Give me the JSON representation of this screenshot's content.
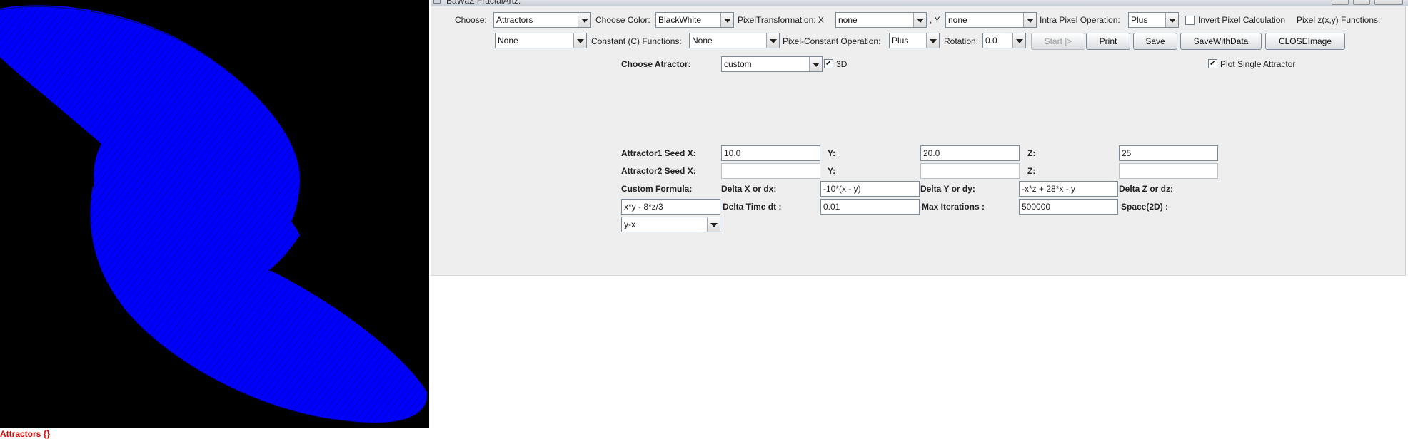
{
  "window": {
    "title": "BaWaZ FractalArtz:"
  },
  "image_panel": {
    "caption": "Attractors {}",
    "background": "#000000",
    "plot_color": "#0000ff"
  },
  "toolbar": {
    "choose_label": "Choose:",
    "choose_value": "Attractors",
    "choose_color_label": "Choose Color:",
    "choose_color_value": "BlackWhite",
    "pixel_transformation_label": "PixelTransformation:  X",
    "pixel_transformation_x": "none",
    "y_label": ",  Y",
    "pixel_transformation_y": "none",
    "intra_pixel_label": "Intra Pixel Operation:",
    "intra_pixel_value": "Plus",
    "invert_label": "Invert Pixel Calculation",
    "invert_checked": false,
    "pixel_functions_label": "Pixel z(x,y) Functions:",
    "pixel_functions_value": "None",
    "constant_functions_label": "Constant (C) Functions:",
    "constant_functions_value": "None",
    "pixel_constant_label": "Pixel-Constant Operation:",
    "pixel_constant_value": "Plus",
    "rotation_label": "Rotation:",
    "rotation_value": "0.0",
    "start_button": "Start |>",
    "print_button": "Print",
    "save_button": "Save",
    "save_with_data_button": "SaveWithData",
    "close_image_button": "CLOSEImage"
  },
  "attractor": {
    "choose_label": "Choose Atractor:",
    "choose_value": "custom",
    "three_d_label": "3D",
    "three_d_checked": true,
    "plot_single_label": "Plot Single Attractor",
    "plot_single_checked": true,
    "attractor1_label": "Attractor1   Seed   X:",
    "attractor2_label": "Attractor2   Seed   X:",
    "y_label": "Y:",
    "z_label": "Z:",
    "seed1_x": "10.0",
    "seed1_y": "20.0",
    "seed1_z": "25",
    "seed2_x": "",
    "seed2_y": "",
    "seed2_z": "",
    "custom_formula_label": "Custom Formula:",
    "delta_x_label": "Delta X or dx:",
    "delta_x_value": "-10*(x - y)",
    "delta_y_label": "Delta Y or dy:",
    "delta_y_value": "-x*z + 28*x - y",
    "delta_z_label": "Delta Z or dz:",
    "delta_z_value": "x*y - 8*z/3",
    "delta_time_label": "Delta Time dt :",
    "delta_time_value": "0.01",
    "max_iterations_label": "Max Iterations  :",
    "max_iterations_value": "500000",
    "space_label": "Space(2D)  :",
    "space_value": "y-x"
  }
}
